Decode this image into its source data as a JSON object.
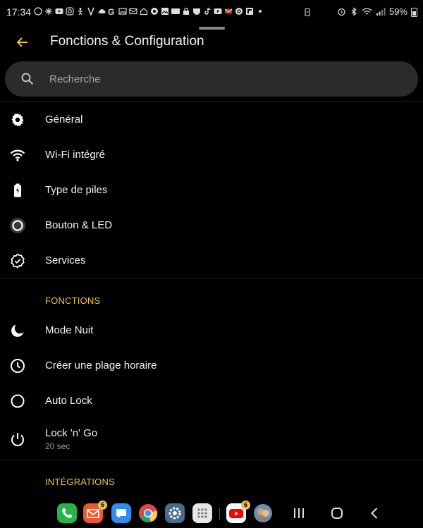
{
  "status_bar": {
    "time": "17:34",
    "battery": "59%",
    "icons_left": [
      "whatsapp-icon",
      "pinwheel-icon",
      "youtube-icon",
      "instagram-icon",
      "stickman-icon",
      "v-icon",
      "cloud-icon",
      "google-icon",
      "image-icon",
      "mail-icon",
      "home-icon",
      "chrome-icon",
      "image-icon",
      "ebay-icon",
      "lock-icon",
      "pocket-icon",
      "tiktok-icon",
      "youtube-icon",
      "mail-icon",
      "grammarly-icon",
      "flipboard-icon",
      "dot-icon"
    ],
    "icons_right": [
      "battery-saver-icon",
      "alarm-icon",
      "bluetooth-icon",
      "wifi-icon",
      "signal-icon"
    ]
  },
  "header": {
    "title": "Fonctions & Configuration",
    "back_icon": "arrow-left-icon"
  },
  "search": {
    "placeholder": "Recherche",
    "value": ""
  },
  "menu": [
    {
      "label": "Général",
      "icon": "gear-icon"
    },
    {
      "label": "Wi-Fi intégré",
      "icon": "wifi-icon"
    },
    {
      "label": "Type de piles",
      "icon": "battery-charging-icon"
    },
    {
      "label": "Bouton & LED",
      "icon": "circle-button-icon"
    },
    {
      "label": "Services",
      "icon": "verified-badge-icon"
    }
  ],
  "sections": {
    "fonctions": {
      "title": "FONCTIONS",
      "items": [
        {
          "label": "Mode Nuit",
          "icon": "moon-icon"
        },
        {
          "label": "Créer une plage horaire",
          "icon": "clock-icon"
        },
        {
          "label": "Auto Lock",
          "icon": "circle-icon"
        },
        {
          "label": "Lock 'n' Go",
          "sub": "20 sec",
          "icon": "power-icon"
        }
      ]
    },
    "integrations": {
      "title": "INTÉGRATIONS"
    }
  },
  "dock": {
    "apps": [
      {
        "name": "phone-app",
        "color": "#27b44a"
      },
      {
        "name": "email-app",
        "color": "#ea5a2e",
        "badge": "6"
      },
      {
        "name": "messages-app",
        "color": "#2f8cf0"
      },
      {
        "name": "chrome-app",
        "color": "#ffffff"
      },
      {
        "name": "settings-app",
        "color": "#4a6b8a"
      },
      {
        "name": "apps-drawer",
        "color": "#e6e6e6"
      },
      {
        "name": "youtube-app",
        "color": "#ffffff",
        "badge": "6"
      },
      {
        "name": "avatar-app",
        "color": "#d9a060"
      }
    ]
  },
  "colors": {
    "accent": "#f2c04d",
    "background": "#000000",
    "surface": "#2b2b2b"
  }
}
